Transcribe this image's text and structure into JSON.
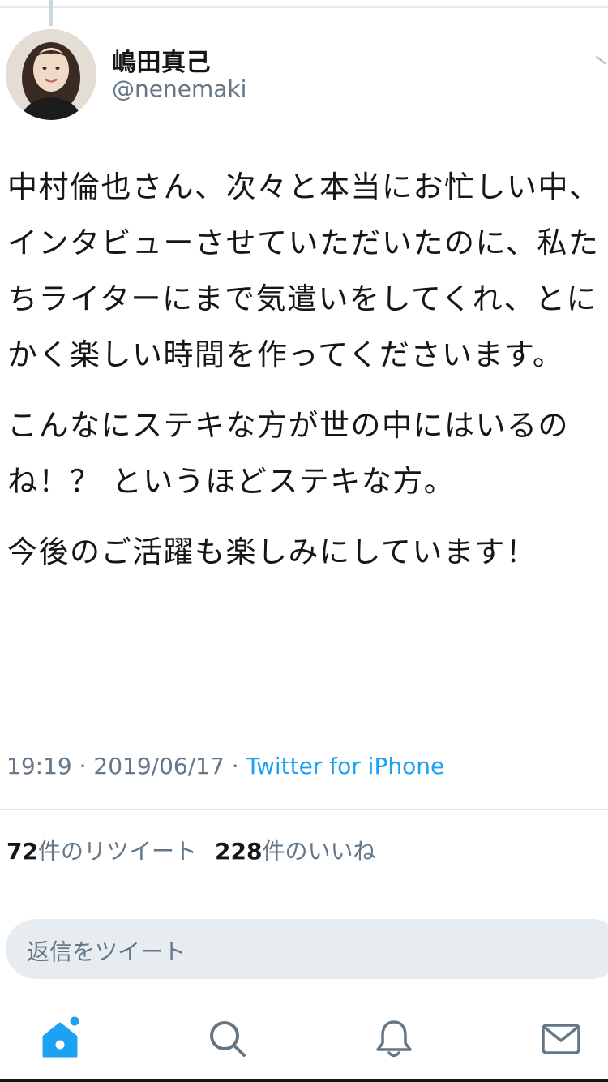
{
  "tweet": {
    "author": {
      "display_name": "嶋田真己",
      "handle": "@nenemaki"
    },
    "paragraphs": [
      "中村倫也さん、次々と本当にお忙しい中、インタビューさせていただいたのに、私たちライターにまで気遣いをしてくれ、とにかく楽しい時間を作ってくださいます。",
      "こんなにステキな方が世の中にはいるのね！？ というほどステキな方。",
      "今後のご活躍も楽しみにしています！"
    ],
    "time": "19:19",
    "separator": "·",
    "date": "2019/06/17",
    "source": "Twitter for iPhone",
    "retweets": {
      "count": "72",
      "label": "件のリツイート"
    },
    "likes": {
      "count": "228",
      "label": "件のいいね"
    }
  },
  "reply": {
    "placeholder": "返信をツイート"
  },
  "tabbar": {
    "items": [
      {
        "icon": "home-icon",
        "active": true,
        "badge": true
      },
      {
        "icon": "search-icon",
        "active": false
      },
      {
        "icon": "bell-icon",
        "active": false
      },
      {
        "icon": "mail-icon",
        "active": false
      }
    ]
  },
  "colors": {
    "accent": "#1da1f2",
    "text": "#14171a",
    "secondary": "#657786",
    "divider": "#e1e8ed",
    "reply_bg": "#e6ecf0"
  }
}
